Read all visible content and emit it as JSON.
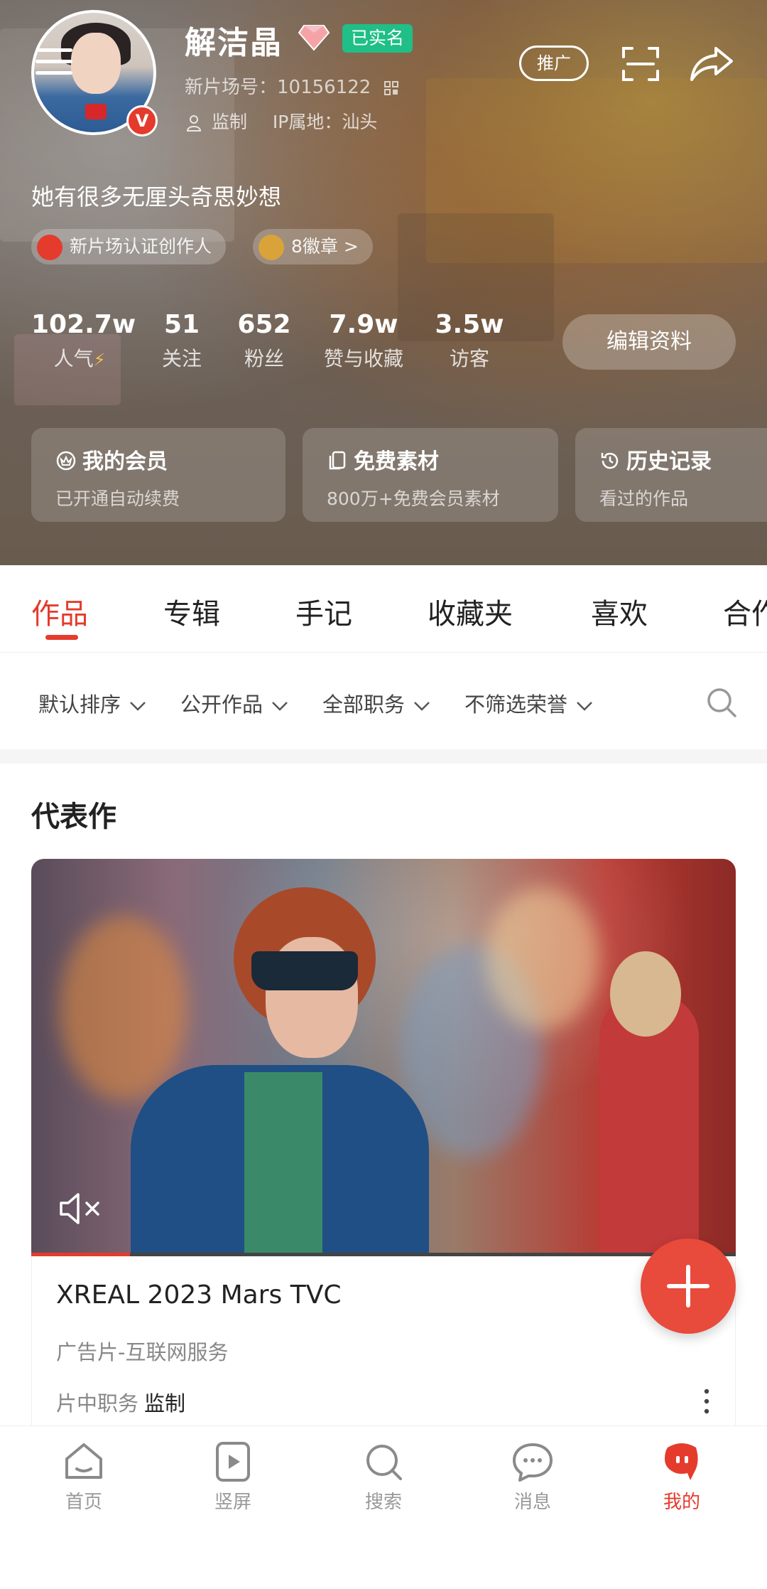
{
  "profile": {
    "name": "解洁晶",
    "verified_label": "已实名",
    "id_line": "新片场号：10156122",
    "role": "监制",
    "ip_location": "IP属地：汕头",
    "bio": "她有很多无厘头奇思妙想",
    "cert_label": "新片场认证创作人",
    "medal_label": "8徽章 >",
    "promote_label": "推广",
    "edit_label": "编辑资料"
  },
  "stats": [
    {
      "value": "102.7w",
      "label": "人气"
    },
    {
      "value": "51",
      "label": "关注"
    },
    {
      "value": "652",
      "label": "粉丝"
    },
    {
      "value": "7.9w",
      "label": "赞与收藏"
    },
    {
      "value": "3.5w",
      "label": "访客"
    }
  ],
  "cards": [
    {
      "title": "我的会员",
      "sub": "已开通自动续费",
      "icon": "member-icon"
    },
    {
      "title": "免费素材",
      "sub": "800万+免费会员素材",
      "icon": "material-icon"
    },
    {
      "title": "历史记录",
      "sub": "看过的作品",
      "icon": "history-icon"
    }
  ],
  "tabs": [
    "作品",
    "专辑",
    "手记",
    "收藏夹",
    "喜欢",
    "合作"
  ],
  "filters": [
    "默认排序",
    "公开作品",
    "全部职务",
    "不筛选荣誉"
  ],
  "section_title": "代表作",
  "featured": {
    "title": "XREAL 2023 Mars TVC",
    "category": "广告片-互联网服务",
    "role_label": "片中职务",
    "role_value": "监制",
    "progress": 0.14
  },
  "bottom_nav": [
    {
      "label": "首页",
      "icon": "home-icon"
    },
    {
      "label": "竖屏",
      "icon": "vertical-play-icon"
    },
    {
      "label": "搜索",
      "icon": "search-icon"
    },
    {
      "label": "消息",
      "icon": "message-icon"
    },
    {
      "label": "我的",
      "icon": "me-icon"
    }
  ],
  "colors": {
    "accent": "#e53b2c",
    "verified": "#1fbf87"
  }
}
